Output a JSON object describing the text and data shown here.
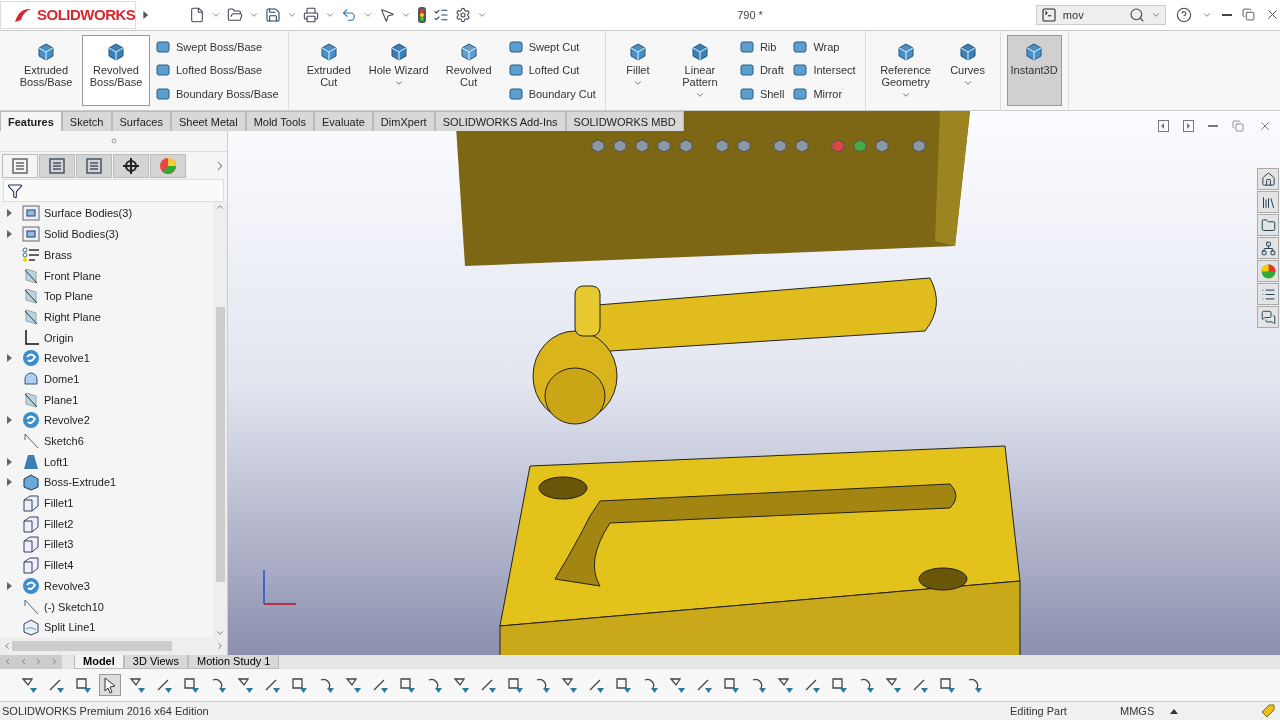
{
  "app": {
    "logo_text": "SOLIDWORKS",
    "title": "790 *",
    "search": {
      "value": "mov"
    }
  },
  "ribbon": {
    "groups": [
      {
        "items": [
          {
            "kind": "large",
            "label": "Extruded Boss/Base",
            "highlighted": false,
            "pressed": false,
            "dropdown": false
          },
          {
            "kind": "large",
            "label": "Revolved Boss/Base",
            "highlighted": true,
            "pressed": false,
            "dropdown": false
          },
          {
            "kind": "stack",
            "items": [
              "Swept Boss/Base",
              "Lofted Boss/Base",
              "Boundary Boss/Base"
            ]
          }
        ]
      },
      {
        "items": [
          {
            "kind": "large",
            "label": "Extruded Cut",
            "highlighted": false,
            "pressed": false,
            "dropdown": false
          },
          {
            "kind": "large",
            "label": "Hole Wizard",
            "highlighted": false,
            "pressed": false,
            "dropdown": true
          },
          {
            "kind": "large",
            "label": "Revolved Cut",
            "highlighted": false,
            "pressed": false,
            "dropdown": false
          },
          {
            "kind": "stack",
            "items": [
              "Swept Cut",
              "Lofted Cut",
              "Boundary Cut"
            ]
          }
        ]
      },
      {
        "items": [
          {
            "kind": "large",
            "label": "Fillet",
            "highlighted": false,
            "pressed": false,
            "dropdown": true
          },
          {
            "kind": "large",
            "label": "Linear Pattern",
            "highlighted": false,
            "pressed": false,
            "dropdown": true
          },
          {
            "kind": "stack",
            "items": [
              "Rib",
              "Draft",
              "Shell"
            ]
          },
          {
            "kind": "stack",
            "items": [
              "Wrap",
              "Intersect",
              "Mirror"
            ]
          }
        ]
      },
      {
        "items": [
          {
            "kind": "large",
            "label": "Reference Geometry",
            "highlighted": false,
            "pressed": false,
            "dropdown": true
          },
          {
            "kind": "large",
            "label": "Curves",
            "highlighted": false,
            "pressed": false,
            "dropdown": true
          }
        ]
      },
      {
        "items": [
          {
            "kind": "large",
            "label": "Instant3D",
            "highlighted": false,
            "pressed": true,
            "dropdown": false
          }
        ]
      }
    ]
  },
  "command_tabs": [
    {
      "label": "Features",
      "selected": true
    },
    {
      "label": "Sketch",
      "selected": false
    },
    {
      "label": "Surfaces",
      "selected": false
    },
    {
      "label": "Sheet Metal",
      "selected": false
    },
    {
      "label": "Mold Tools",
      "selected": false
    },
    {
      "label": "Evaluate",
      "selected": false
    },
    {
      "label": "DimXpert",
      "selected": false
    },
    {
      "label": "SOLIDWORKS Add-Ins",
      "selected": false
    },
    {
      "label": "SOLIDWORKS MBD",
      "selected": false
    }
  ],
  "panel_tabs": [
    {
      "selected": true
    },
    {
      "selected": false
    },
    {
      "selected": false
    },
    {
      "selected": false
    },
    {
      "selected": false
    }
  ],
  "tree": [
    {
      "label": "Surface Bodies(3)",
      "kind": "folder",
      "expandable": true
    },
    {
      "label": "Solid Bodies(3)",
      "kind": "folder",
      "expandable": true
    },
    {
      "label": "Brass",
      "kind": "material",
      "expandable": false
    },
    {
      "label": "Front Plane",
      "kind": "plane",
      "expandable": false
    },
    {
      "label": "Top Plane",
      "kind": "plane",
      "expandable": false
    },
    {
      "label": "Right Plane",
      "kind": "plane",
      "expandable": false
    },
    {
      "label": "Origin",
      "kind": "origin",
      "expandable": false
    },
    {
      "label": "Revolve1",
      "kind": "revolve",
      "expandable": true
    },
    {
      "label": "Dome1",
      "kind": "dome",
      "expandable": false
    },
    {
      "label": "Plane1",
      "kind": "plane",
      "expandable": false
    },
    {
      "label": "Revolve2",
      "kind": "revolve",
      "expandable": true
    },
    {
      "label": "Sketch6",
      "kind": "sketch",
      "expandable": false
    },
    {
      "label": "Loft1",
      "kind": "loft",
      "expandable": true
    },
    {
      "label": "Boss-Extrude1",
      "kind": "extrude",
      "expandable": true
    },
    {
      "label": "Fillet1",
      "kind": "fillet",
      "expandable": false
    },
    {
      "label": "Fillet2",
      "kind": "fillet",
      "expandable": false
    },
    {
      "label": "Fillet3",
      "kind": "fillet",
      "expandable": false
    },
    {
      "label": "Fillet4",
      "kind": "fillet",
      "expandable": false
    },
    {
      "label": "Revolve3",
      "kind": "revolve",
      "expandable": true
    },
    {
      "label": "(-) Sketch10",
      "kind": "sketch",
      "expandable": false
    },
    {
      "label": "Split Line1",
      "kind": "split",
      "expandable": false
    }
  ],
  "bottom_tabs": [
    {
      "label": "Model",
      "selected": true
    },
    {
      "label": "3D Views",
      "selected": false
    },
    {
      "label": "Motion Study 1",
      "selected": false
    }
  ],
  "status_bar": {
    "edition": "SOLIDWORKS Premium 2016 x64 Edition",
    "mode": "Editing Part",
    "units": "MMGS"
  }
}
